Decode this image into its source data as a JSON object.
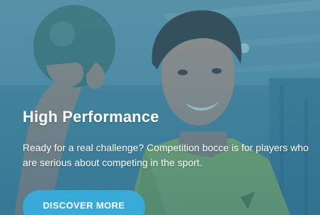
{
  "card": {
    "heading": "High Performance",
    "description": "Ready for a real challenge? Competition bocce is for players who are serious about competing in the sport.",
    "cta_label": "DISCOVER MORE",
    "colors": {
      "overlay": "#2f7fa3",
      "button": "#39a9d8",
      "text": "#ffffff"
    },
    "image_icon": "player-holding-bocce-ball-photo"
  }
}
